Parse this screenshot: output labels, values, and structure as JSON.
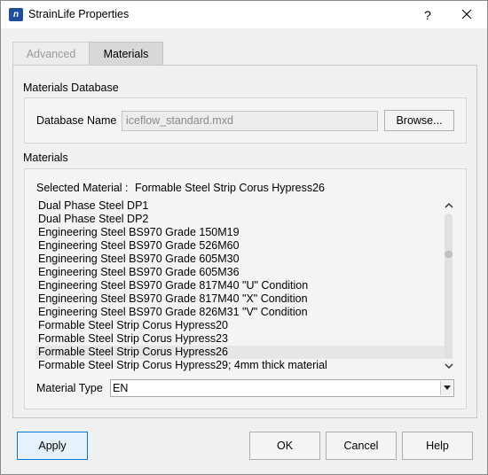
{
  "window": {
    "title": "StrainLife Properties",
    "app_icon": "nCode-app-icon",
    "app_icon_text": "n",
    "help_label": "?",
    "close_icon": "close-icon"
  },
  "tabs": [
    {
      "label": "Advanced",
      "active": false
    },
    {
      "label": "Materials",
      "active": true
    }
  ],
  "database": {
    "section_label": "Materials Database",
    "field_label": "Database Name",
    "value": "iceflow_standard.mxd",
    "browse_label": "Browse..."
  },
  "materials": {
    "section_label": "Materials",
    "selected_prefix": "Selected Material :",
    "selected_value": "Formable Steel Strip Corus Hypress26",
    "items": [
      "Dual Phase Steel DP1",
      "Dual Phase Steel DP2",
      "Engineering Steel BS970 Grade 150M19",
      "Engineering Steel BS970 Grade 526M60",
      "Engineering Steel BS970 Grade 605M30",
      "Engineering Steel BS970 Grade 605M36",
      "Engineering Steel BS970 Grade 817M40 \"U\" Condition",
      "Engineering Steel BS970 Grade 817M40 \"X\" Condition",
      "Engineering Steel BS970 Grade 826M31 \"V\" Condition",
      "Formable Steel Strip Corus Hypress20",
      "Formable Steel Strip Corus Hypress23",
      "Formable Steel Strip Corus Hypress26",
      "Formable Steel Strip Corus Hypress29; 4mm thick material"
    ],
    "selected_index": 11,
    "type_label": "Material Type",
    "type_value": "EN"
  },
  "buttons": {
    "apply": "Apply",
    "ok": "OK",
    "cancel": "Cancel",
    "help": "Help"
  },
  "colors": {
    "accent": "#0078d7",
    "app_icon": "#1f4e9c",
    "selection": "#e6e6e6"
  }
}
